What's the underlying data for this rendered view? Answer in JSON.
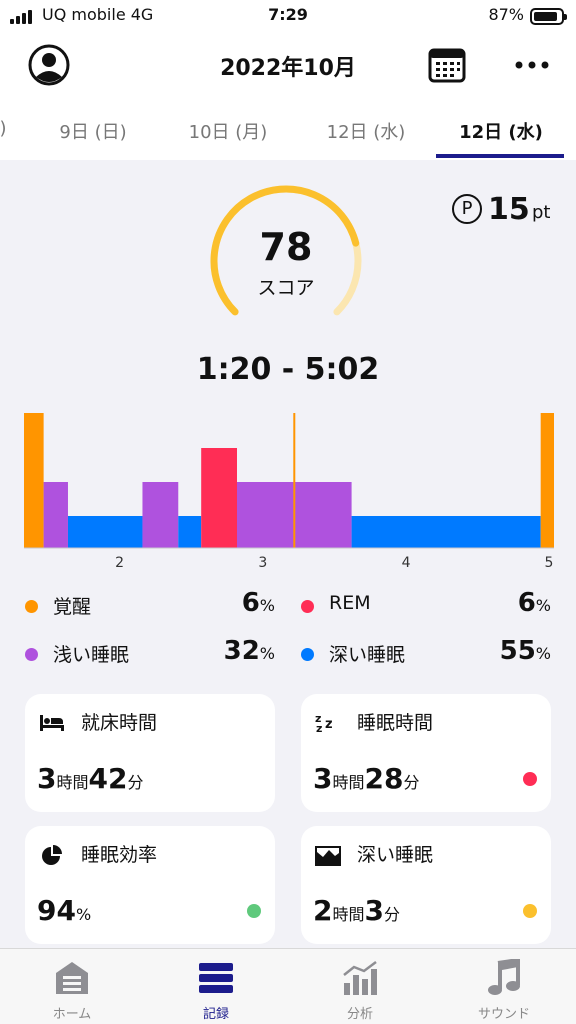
{
  "status_bar": {
    "carrier": "UQ mobile  4G",
    "time": "7:29",
    "battery_percent": "87%",
    "battery_level": 0.87
  },
  "header": {
    "title": "2022年10月"
  },
  "date_tabs": {
    "items": [
      {
        "label": ")"
      },
      {
        "label": "9日 (日)"
      },
      {
        "label": "10日 (月)"
      },
      {
        "label": "12日 (水)"
      },
      {
        "label": "12日 (水)"
      }
    ],
    "active_index": 4
  },
  "score": {
    "value": "78",
    "label": "スコア",
    "fraction": 0.78
  },
  "points": {
    "icon": "P",
    "value": "15",
    "unit": "pt"
  },
  "sleep_range": "1:20 - 5:02",
  "colors": {
    "awake": "#ff9500",
    "rem": "#ff2d55",
    "light": "#af52de",
    "deep": "#007aff",
    "accent": "#1c1c8c",
    "gauge": "#fbc02d",
    "gauge_track": "#fbe6b0",
    "good": "#5fc97c"
  },
  "chart_data": {
    "type": "bar",
    "subtype": "sleep-hypnogram",
    "x_ticks": [
      "2",
      "3",
      "4",
      "5"
    ],
    "x_tick_hours": [
      2,
      3,
      4,
      5
    ],
    "x_range_hours": [
      1.333,
      5.033
    ],
    "marker_hour": 3.22,
    "stages": [
      "awake",
      "rem",
      "light",
      "deep"
    ],
    "segments": [
      {
        "stage": "awake",
        "start": 1.333,
        "end": 1.47
      },
      {
        "stage": "light",
        "start": 1.47,
        "end": 1.64
      },
      {
        "stage": "deep",
        "start": 1.64,
        "end": 2.16
      },
      {
        "stage": "light",
        "start": 2.16,
        "end": 2.41
      },
      {
        "stage": "deep",
        "start": 2.41,
        "end": 2.57
      },
      {
        "stage": "rem",
        "start": 2.57,
        "end": 2.82
      },
      {
        "stage": "light",
        "start": 2.82,
        "end": 3.62
      },
      {
        "stage": "deep",
        "start": 3.62,
        "end": 4.94
      },
      {
        "stage": "awake",
        "start": 4.94,
        "end": 5.033
      }
    ]
  },
  "legend": [
    {
      "name": "覚醒",
      "value": "6",
      "unit": "%",
      "color": "#ff9500"
    },
    {
      "name": "REM",
      "value": "6",
      "unit": "%",
      "color": "#ff2d55"
    },
    {
      "name": "浅い睡眠",
      "value": "32",
      "unit": "%",
      "color": "#af52de"
    },
    {
      "name": "深い睡眠",
      "value": "55",
      "unit": "%",
      "color": "#007aff"
    }
  ],
  "cards": [
    {
      "title": "就床時間",
      "icon": "bed-icon",
      "v1": "3",
      "u1": "時間",
      "v2": "42",
      "u2": "分",
      "dot": ""
    },
    {
      "title": "睡眠時間",
      "icon": "zzz-icon",
      "v1": "3",
      "u1": "時間",
      "v2": "28",
      "u2": "分",
      "dot": "#ff2d55"
    },
    {
      "title": "睡眠効率",
      "icon": "pie-icon",
      "v1": "94",
      "u1": "%",
      "v2": "",
      "u2": "",
      "dot": "#5fc97c"
    },
    {
      "title": "深い睡眠",
      "icon": "mountain-icon",
      "v1": "2",
      "u1": "時間",
      "v2": "3",
      "u2": "分",
      "dot": "#fbc02d"
    }
  ],
  "nav": {
    "items": [
      {
        "label": "ホーム",
        "icon": "home-icon"
      },
      {
        "label": "記録",
        "icon": "records-icon"
      },
      {
        "label": "分析",
        "icon": "analytics-icon"
      },
      {
        "label": "サウンド",
        "icon": "music-note-icon"
      }
    ],
    "active_index": 1
  }
}
